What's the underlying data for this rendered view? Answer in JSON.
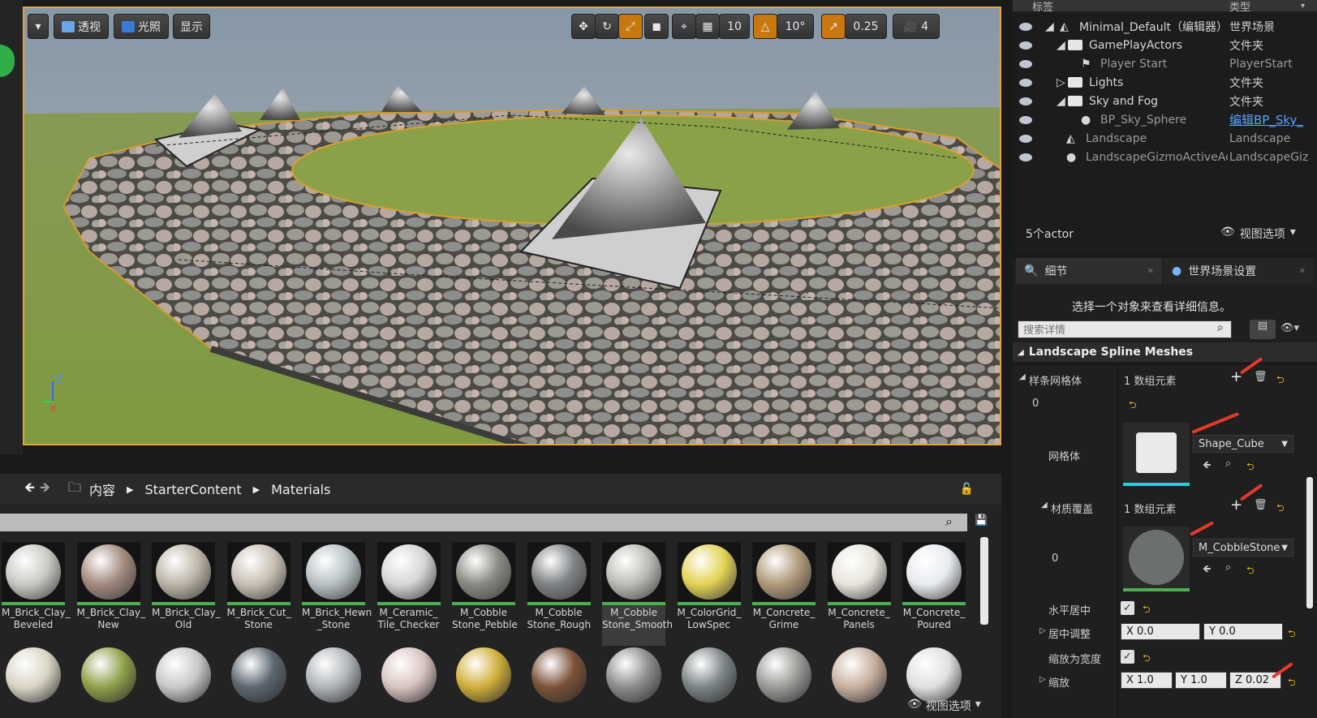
{
  "viewport": {
    "toolbar": {
      "perspective": "透视",
      "lit": "光照",
      "show": "显示",
      "grid_size": "10",
      "rot_snap": "10°",
      "scale_snap": "0.25",
      "cam_speed": "4"
    },
    "axes": {
      "z": "Z"
    }
  },
  "outliner": {
    "col_label": "标签",
    "col_type": "类型",
    "rows": [
      {
        "name": "Minimal_Default（编辑器）",
        "type": "世界场景"
      },
      {
        "name": "GamePlayActors",
        "type": "文件夹"
      },
      {
        "name": "Player Start",
        "type": "PlayerStart"
      },
      {
        "name": "Lights",
        "type": "文件夹"
      },
      {
        "name": "Sky and Fog",
        "type": "文件夹"
      },
      {
        "name": "BP_Sky_Sphere",
        "type": "编辑BP_Sky_"
      },
      {
        "name": "Landscape",
        "type": "Landscape"
      },
      {
        "name": "LandscapeGizmoActiveAc",
        "type": "LandscapeGiz"
      }
    ],
    "actor_count": "5个actor",
    "view_options": "视图选项"
  },
  "details": {
    "tab_details": "细节",
    "tab_world": "世界场景设置",
    "hint": "选择一个对象来查看详细信息。",
    "search_placeholder": "搜索详情",
    "section": "Landscape Spline Meshes",
    "spline_meshes_label": "样条网格体",
    "array_count_1": "1 数组元素",
    "index_0": "0",
    "mesh_label": "网格体",
    "mesh_value": "Shape_Cube",
    "material_override_label": "材质覆盖",
    "array_count_2": "1 数组元素",
    "mat_index": "0",
    "material_value": "M_CobbleStone_Pe",
    "center_h": "水平居中",
    "center_adjust": "居中调整",
    "offset_x": "X  0.0",
    "offset_y": "Y  0.0",
    "scale_to_width": "缩放为宽度",
    "scale": "缩放",
    "scale_x": "X  1.0",
    "scale_y": "Y  1.0",
    "scale_z": "Z  0.02"
  },
  "content_browser": {
    "breadcrumb": [
      "内容",
      "StarterContent",
      "Materials"
    ],
    "view_options": "视图选项",
    "assets": [
      {
        "name": "M_Brick_Clay_\nBeveled",
        "color": "#c9c9c4"
      },
      {
        "name": "M_Brick_Clay_\nNew",
        "color": "#a38a7e"
      },
      {
        "name": "M_Brick_Clay_\nOld",
        "color": "#bdb6a8"
      },
      {
        "name": "M_Brick_Cut_\nStone",
        "color": "#c8c0b3"
      },
      {
        "name": "M_Brick_Hewn\n_Stone",
        "color": "#b8c0c4"
      },
      {
        "name": "M_Ceramic_\nTile_Checker",
        "color": "#d6d6d6"
      },
      {
        "name": "M_Cobble\nStone_Pebble",
        "color": "#8a8a84"
      },
      {
        "name": "M_Cobble\nStone_Rough",
        "color": "#7f8284"
      },
      {
        "name": "M_Cobble\nStone_Smooth",
        "color": "#bcbcb6"
      },
      {
        "name": "M_ColorGrid_\nLowSpec",
        "color": "#e3d355"
      },
      {
        "name": "M_Concrete_\nGrime",
        "color": "#b09a7a"
      },
      {
        "name": "M_Concrete_\nPanels",
        "color": "#e7e4dc"
      },
      {
        "name": "M_Concrete_\nPoured",
        "color": "#e8ebee"
      }
    ],
    "row2_colors": [
      "#d9d4c4",
      "#8fa04a",
      "#c6c8ca",
      "#5c6670",
      "#aeb4b8",
      "#d8c4c0",
      "#cfae3a",
      "#7a5238",
      "#8a8c8e",
      "#7c8486",
      "#9a9c98",
      "#c8b0a0",
      "#e0e0e0"
    ]
  }
}
